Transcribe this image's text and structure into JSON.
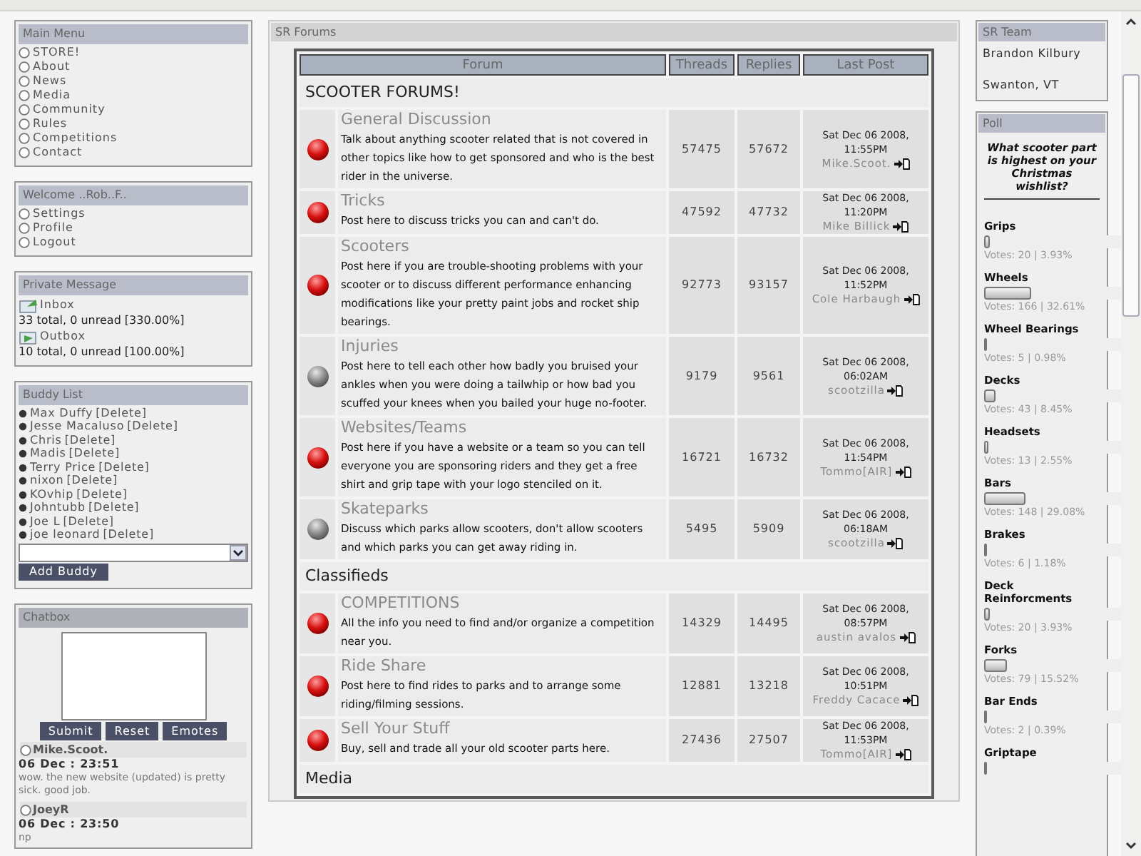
{
  "main_menu": {
    "title": "Main Menu",
    "items": [
      "STORE!",
      "About",
      "News",
      "Media",
      "Community",
      "Rules",
      "Competitions",
      "Contact"
    ]
  },
  "welcome": {
    "title": "Welcome ..Rob..F..",
    "items": [
      "Settings",
      "Profile",
      "Logout"
    ]
  },
  "private_message": {
    "title": "Private Message",
    "folders": [
      {
        "kind": "inbox",
        "label": "Inbox",
        "summary": "33 total, 0 unread [330.00%]"
      },
      {
        "kind": "outbox",
        "label": "Outbox",
        "summary": "10 total, 0 unread [100.00%]"
      }
    ]
  },
  "buddy_list": {
    "title": "Buddy List",
    "buddies": [
      {
        "name": "Max Duffy",
        "action": "[Delete]"
      },
      {
        "name": "Jesse Macaluso",
        "action": "[Delete]"
      },
      {
        "name": "Chris",
        "action": "[Delete]"
      },
      {
        "name": "Madis",
        "action": "[Delete]"
      },
      {
        "name": "Terry Price",
        "action": "[Delete]"
      },
      {
        "name": "nixon",
        "action": "[Delete]"
      },
      {
        "name": "KOvhip",
        "action": "[Delete]"
      },
      {
        "name": "Johntubb",
        "action": "[Delete]"
      },
      {
        "name": "Joe L",
        "action": "[Delete]"
      },
      {
        "name": "joe leonard",
        "action": "[Delete]"
      }
    ],
    "add_button": "Add Buddy"
  },
  "chatbox": {
    "title": "Chatbox",
    "buttons": [
      "Submit",
      "Reset",
      "Emotes"
    ],
    "messages": [
      {
        "user": "Mike.Scoot.",
        "time": "06 Dec : 23:51",
        "text": "wow. the new website (updated) is pretty sick. good job."
      },
      {
        "user": "JoeyR",
        "time": "06 Dec : 23:50",
        "text": "np"
      }
    ]
  },
  "forums": {
    "title": "SR Forums",
    "columns": [
      "Forum",
      "Threads",
      "Replies",
      "Last Post"
    ],
    "categories": [
      {
        "name": "SCOOTER FORUMS!",
        "forums": [
          {
            "unread": true,
            "name": "General Discussion",
            "description": "Talk about anything scooter related that is not covered in other topics like how to get sponsored and who is the best rider in the universe.",
            "threads": "57475",
            "replies": "57672",
            "date": "Sat Dec 06 2008,",
            "time": "11:55PM",
            "user": "Mike.Scoot."
          },
          {
            "unread": true,
            "name": "Tricks",
            "description": "Post here to discuss tricks you can and can't do.",
            "threads": "47592",
            "replies": "47732",
            "date": "Sat Dec 06 2008,",
            "time": "11:20PM",
            "user": "Mike Billick"
          },
          {
            "unread": true,
            "name": "Scooters",
            "description": "Post here if you are trouble-shooting problems with your scooter or to discuss different performance enhancing modifications like your pretty paint jobs and rocket ship bearings.",
            "threads": "92773",
            "replies": "93157",
            "date": "Sat Dec 06 2008,",
            "time": "11:52PM",
            "user": "Cole Harbaugh"
          },
          {
            "unread": false,
            "name": "Injuries",
            "description": "Post here to tell each other how badly you bruised your ankles when you were doing a tailwhip or how bad you scuffed your knees when you bailed your huge no-footer.",
            "threads": "9179",
            "replies": "9561",
            "date": "Sat Dec 06 2008,",
            "time": "06:02AM",
            "user": "scootzilla"
          },
          {
            "unread": true,
            "name": "Websites/Teams",
            "description": "Post here if you have a website or a team so you can tell everyone you are sponsoring riders and they get a free shirt and grip tape with your logo stenciled on it.",
            "threads": "16721",
            "replies": "16732",
            "date": "Sat Dec 06 2008,",
            "time": "11:54PM",
            "user": "Tommo[AIR]"
          },
          {
            "unread": false,
            "name": "Skateparks",
            "description": "Discuss which parks allow scooters, don't allow scooters and which parks you can get away riding in.",
            "threads": "5495",
            "replies": "5909",
            "date": "Sat Dec 06 2008,",
            "time": "06:18AM",
            "user": "scootzilla"
          }
        ]
      },
      {
        "name": "Classifieds",
        "forums": [
          {
            "unread": true,
            "name": "COMPETITIONS",
            "description": "All the info you need to find and/or organize a competition near you.",
            "threads": "14329",
            "replies": "14495",
            "date": "Sat Dec 06 2008,",
            "time": "08:57PM",
            "user": "austin avalos"
          },
          {
            "unread": true,
            "name": "Ride Share",
            "description": "Post here to find rides to parks and to arrange some riding/filming sessions.",
            "threads": "12881",
            "replies": "13218",
            "date": "Sat Dec 06 2008,",
            "time": "10:51PM",
            "user": "Freddy Cacace"
          },
          {
            "unread": true,
            "name": "Sell Your Stuff",
            "description": "Buy, sell and trade all your old scooter parts here.",
            "threads": "27436",
            "replies": "27507",
            "date": "Sat Dec 06 2008,",
            "time": "11:53PM",
            "user": "Tommo[AIR]"
          }
        ]
      },
      {
        "name": "Media"
      }
    ]
  },
  "team": {
    "title": "SR Team",
    "lines": [
      "Brandon Kilbury",
      "Swanton, VT"
    ]
  },
  "poll": {
    "title": "Poll",
    "question": "What scooter part is highest on your Christmas wishlist?",
    "options": [
      {
        "label": "Grips",
        "level": 0.0393,
        "votes": "Votes: 20 | 3.93%"
      },
      {
        "label": "Wheels",
        "level": 0.3261,
        "votes": "Votes: 166 | 32.61%"
      },
      {
        "label": "Wheel Bearings",
        "level": 0.0098,
        "votes": "Votes: 5 | 0.98%"
      },
      {
        "label": "Decks",
        "level": 0.0845,
        "votes": "Votes: 43 | 8.45%"
      },
      {
        "label": "Headsets",
        "level": 0.0255,
        "votes": "Votes: 13 | 2.55%"
      },
      {
        "label": "Bars",
        "level": 0.2908,
        "votes": "Votes: 148 | 29.08%"
      },
      {
        "label": "Brakes",
        "level": 0.0118,
        "votes": "Votes: 6 | 1.18%"
      },
      {
        "label": "Deck Reinforcments",
        "level": 0.0393,
        "votes": "Votes: 20 | 3.93%"
      },
      {
        "label": "Forks",
        "level": 0.1552,
        "votes": "Votes: 79 | 15.52%"
      },
      {
        "label": "Bar Ends",
        "level": 0.0039,
        "votes": "Votes: 2 | 0.39%"
      },
      {
        "label": "Griptape",
        "level": 0.0138
      }
    ]
  }
}
